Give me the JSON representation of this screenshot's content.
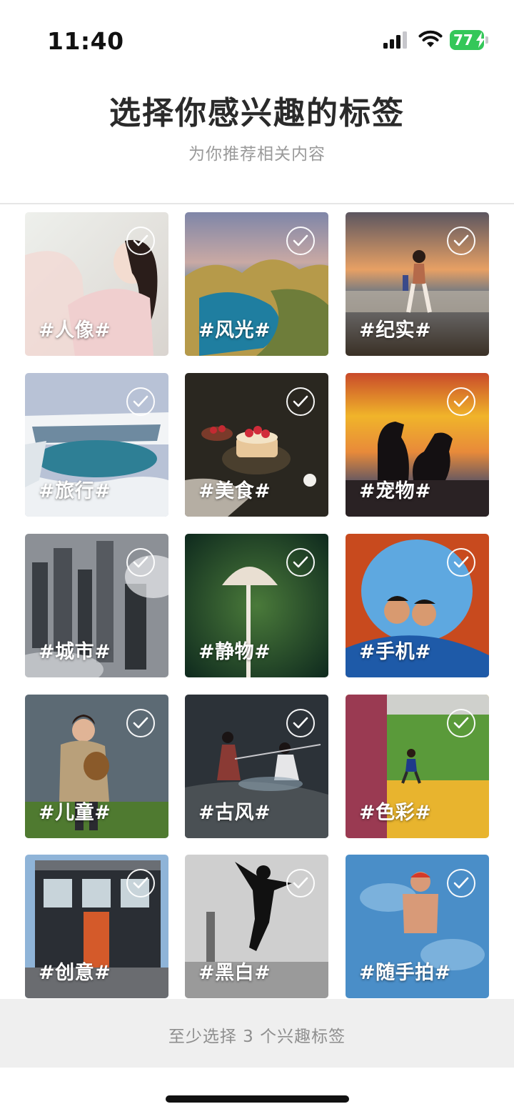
{
  "status_bar": {
    "time": "11:40",
    "battery_level": "77",
    "battery_color": "#34c759"
  },
  "header": {
    "title": "选择你感兴趣的标签",
    "subtitle": "为你推荐相关内容"
  },
  "tags": [
    {
      "label": "#人像#",
      "icon": "checkmark-circle-icon",
      "selected": false
    },
    {
      "label": "#风光#",
      "icon": "checkmark-circle-icon",
      "selected": false
    },
    {
      "label": "#纪实#",
      "icon": "checkmark-circle-icon",
      "selected": false
    },
    {
      "label": "#旅行#",
      "icon": "checkmark-circle-icon",
      "selected": false
    },
    {
      "label": "#美食#",
      "icon": "checkmark-circle-icon",
      "selected": false
    },
    {
      "label": "#宠物#",
      "icon": "checkmark-circle-icon",
      "selected": false
    },
    {
      "label": "#城市#",
      "icon": "checkmark-circle-icon",
      "selected": false
    },
    {
      "label": "#静物#",
      "icon": "checkmark-circle-icon",
      "selected": false
    },
    {
      "label": "#手机#",
      "icon": "checkmark-circle-icon",
      "selected": false
    },
    {
      "label": "#儿童#",
      "icon": "checkmark-circle-icon",
      "selected": false
    },
    {
      "label": "#古风#",
      "icon": "checkmark-circle-icon",
      "selected": false
    },
    {
      "label": "#色彩#",
      "icon": "checkmark-circle-icon",
      "selected": false
    },
    {
      "label": "#创意#",
      "icon": "checkmark-circle-icon",
      "selected": false
    },
    {
      "label": "#黑白#",
      "icon": "checkmark-circle-icon",
      "selected": false
    },
    {
      "label": "#随手拍#",
      "icon": "checkmark-circle-icon",
      "selected": false
    }
  ],
  "footer": {
    "button_label": "至少选择 3 个兴趣标签"
  }
}
